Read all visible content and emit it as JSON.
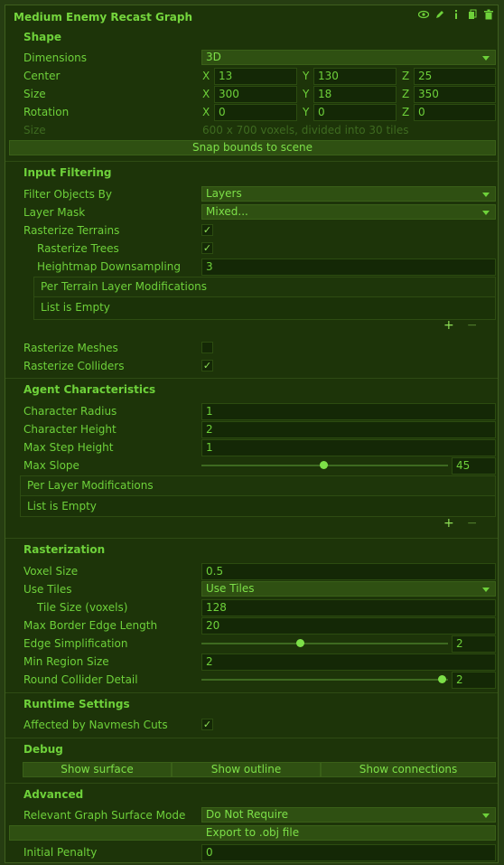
{
  "header": {
    "title": "Medium Enemy Recast Graph"
  },
  "shape": {
    "section": "Shape",
    "dimensions_label": "Dimensions",
    "dimensions_value": "3D",
    "center_label": "Center",
    "center": {
      "x": "13",
      "y": "130",
      "z": "25"
    },
    "size_label": "Size",
    "size": {
      "x": "300",
      "y": "18",
      "z": "350"
    },
    "rotation_label": "Rotation",
    "rotation": {
      "x": "0",
      "y": "0",
      "z": "0"
    },
    "size_info_label": "Size",
    "size_info": "600 x 700 voxels, divided into 30 tiles",
    "snap_button": "Snap bounds to scene",
    "axes": {
      "x": "X",
      "y": "Y",
      "z": "Z"
    }
  },
  "input": {
    "section": "Input Filtering",
    "filter_label": "Filter Objects By",
    "filter_value": "Layers",
    "layermask_label": "Layer Mask",
    "layermask_value": "Mixed...",
    "terrains_label": "Rasterize Terrains",
    "trees_label": "Rasterize Trees",
    "heightmap_label": "Heightmap Downsampling",
    "heightmap_value": "3",
    "terrain_list_title": "Per Terrain Layer Modifications",
    "terrain_list_empty": "List is Empty",
    "meshes_label": "Rasterize Meshes",
    "colliders_label": "Rasterize Colliders"
  },
  "agent": {
    "section": "Agent Characteristics",
    "radius_label": "Character Radius",
    "radius_value": "1",
    "height_label": "Character Height",
    "height_value": "2",
    "step_label": "Max Step Height",
    "step_value": "1",
    "slope_label": "Max Slope",
    "slope_value": "45",
    "layer_list_title": "Per Layer Modifications",
    "layer_list_empty": "List is Empty"
  },
  "raster": {
    "section": "Rasterization",
    "voxel_label": "Voxel Size",
    "voxel_value": "0.5",
    "tiles_label": "Use Tiles",
    "tiles_value": "Use Tiles",
    "tilesize_label": "Tile Size (voxels)",
    "tilesize_value": "128",
    "border_label": "Max Border Edge Length",
    "border_value": "20",
    "edge_label": "Edge Simplification",
    "edge_value": "2",
    "region_label": "Min Region Size",
    "region_value": "2",
    "collider_label": "Round Collider Detail",
    "collider_value": "2"
  },
  "runtime": {
    "section": "Runtime Settings",
    "navmesh_label": "Affected by Navmesh Cuts"
  },
  "debug": {
    "section": "Debug",
    "surface": "Show surface",
    "outline": "Show outline",
    "connections": "Show connections"
  },
  "advanced": {
    "section": "Advanced",
    "surface_mode_label": "Relevant Graph Surface Mode",
    "surface_mode_value": "Do Not Require",
    "export_button": "Export to .obj file",
    "penalty_label": "Initial Penalty",
    "penalty_value": "0"
  },
  "symbols": {
    "check": "✓",
    "plus": "+",
    "minus": "−"
  },
  "colors": {
    "background": "#1d3409",
    "accent": "#6ed13a",
    "field": "#142806",
    "button": "#2f5012"
  }
}
